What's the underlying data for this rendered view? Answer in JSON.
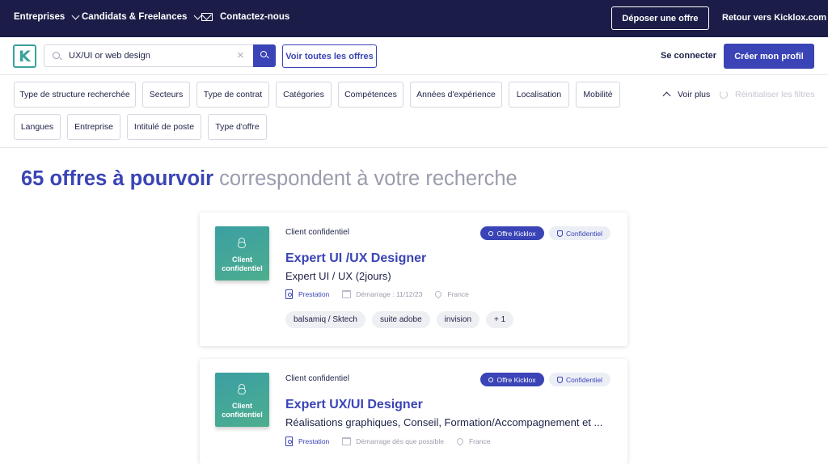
{
  "topnav": {
    "entreprises": "Entreprises",
    "candidats": "Candidats & Freelances",
    "contact": "Contactez-nous",
    "deposer": "Déposer une offre",
    "retour": "Retour vers Kicklox.com"
  },
  "search": {
    "logo_letter": "K",
    "query": "UX/UI or web design",
    "clear_glyph": "×",
    "voir_toutes": "Voir toutes les offres",
    "se_connecter": "Se connecter",
    "creer_profil": "Créer mon profil"
  },
  "filters": {
    "row1": [
      "Type de structure recherchée",
      "Secteurs",
      "Type de contrat",
      "Catégories",
      "Compétences",
      "Années d'expérience",
      "Localisation",
      "Mobilité"
    ],
    "row2": [
      "Langues",
      "Entreprise",
      "Intitulé de poste",
      "Type d'offre"
    ],
    "voir_plus": "Voir plus",
    "reinitialiser": "Réinitialiser les filtres"
  },
  "results": {
    "count_text": "65 offres à pourvoir",
    "rest_text": "correspondent à votre recherche"
  },
  "offers": [
    {
      "thumb_line1": "Client",
      "thumb_line2": "confidentiel",
      "client": "Client confidentiel",
      "badge_kicklox": "Offre Kicklox",
      "badge_conf": "Confidentiel",
      "title": "Expert UI /UX Designer",
      "subtitle": "Expert UI / UX (2jours)",
      "contract": "Prestation",
      "start": "Démarrage : 11/12/23",
      "location": "France",
      "tags": [
        "balsamiq / Sktech",
        "suite adobe",
        "invision",
        "+ 1"
      ]
    },
    {
      "thumb_line1": "Client",
      "thumb_line2": "confidentiel",
      "client": "Client confidentiel",
      "badge_kicklox": "Offre Kicklox",
      "badge_conf": "Confidentiel",
      "title": "Expert UX/UI Designer",
      "subtitle": "Réalisations graphiques, Conseil, Formation/Accompagnement et ...",
      "contract": "Prestation",
      "start": "Démarrage dès que possible",
      "location": "France",
      "tags": []
    }
  ],
  "colors": {
    "navy": "#1b1d48",
    "brand_blue": "#3a44b6",
    "teal": "#3aa39b",
    "muted": "#9a9cad"
  }
}
